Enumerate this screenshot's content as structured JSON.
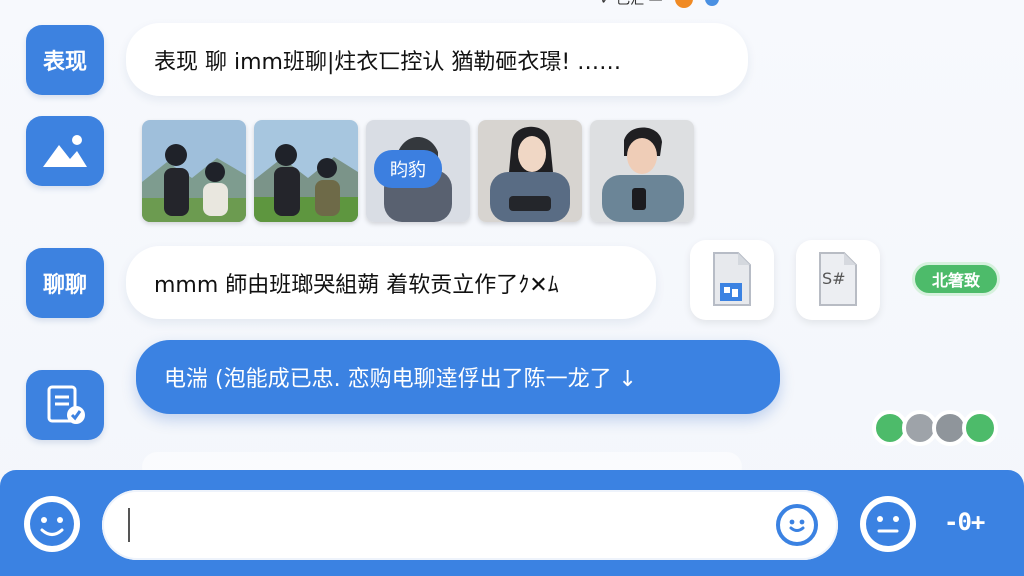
{
  "top": {
    "fragment_text": "✓ 已汇 —"
  },
  "messages": [
    {
      "avatar_label": "表现",
      "text": "表现 聊 imm班聊|炷衣匸控认 猶勒砸衣璟!  ……"
    },
    {
      "avatar_label": "",
      "photo_tag": "盷豹"
    },
    {
      "avatar_label": "聊聊",
      "text": "mmm 師由班瑯哭組蒴 着软贡立作了ｸ✕ﾑ"
    },
    {
      "avatar_label": "",
      "text": "电湍 (泡能成已忠. 恋购电聊逹俘出了陈一龙了 ↓"
    }
  ],
  "attachments": {
    "file2_label": "S#",
    "green_pill": "北箸致"
  },
  "colors": {
    "accent": "#3b82e2",
    "green": "#4dbb6a",
    "orange": "#f08a24"
  },
  "icons": {
    "image": "image-icon",
    "document": "document-check-icon",
    "file": "file-icon",
    "emoji": "emoji-icon",
    "input_emoji": "emoji-icon",
    "neutral_face": "neutral-face-icon",
    "more": "plus-menu-icon"
  },
  "input": {
    "value": ""
  },
  "right_glyph": "-0+"
}
